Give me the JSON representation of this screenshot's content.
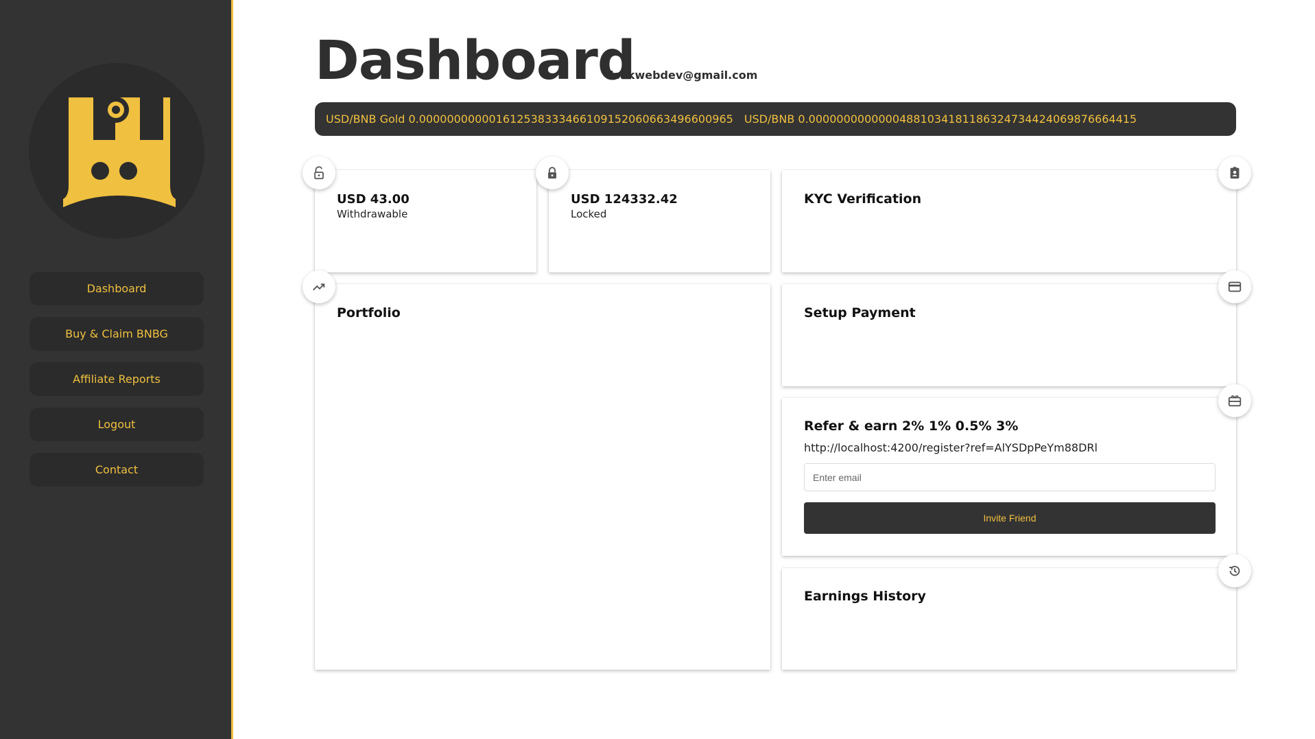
{
  "colors": {
    "sidebar": "#333333",
    "accent": "#f0c040",
    "card": "#ffffff",
    "ticker_bg": "#333333"
  },
  "sidebar": {
    "logo": "crown-logo",
    "items": [
      {
        "label": "Dashboard"
      },
      {
        "label": "Buy & Claim BNBG"
      },
      {
        "label": "Affiliate Reports"
      },
      {
        "label": "Logout"
      },
      {
        "label": "Contact"
      }
    ]
  },
  "header": {
    "title": "Dashboard",
    "email": "isakwebdev@gmail.com"
  },
  "ticker": [
    "USD/BNB Gold 0.0000000000016125383334661091520606634966009​65",
    "USD/BNB 0.000000000000048810341811863247344240698766644​15"
  ],
  "balances": {
    "withdrawable": {
      "amount": "USD 43.00",
      "label": "Withdrawable",
      "icon": "lock-open-icon"
    },
    "locked": {
      "amount": "USD 124332.42",
      "label": "Locked",
      "icon": "lock-icon"
    }
  },
  "kyc": {
    "title": "KYC Verification",
    "icon": "badge-icon"
  },
  "portfolio": {
    "title": "Portfolio",
    "icon": "trending-up-icon"
  },
  "payment": {
    "title": "Setup Payment",
    "icon": "credit-card-icon"
  },
  "refer": {
    "title": "Refer & earn 2% 1% 0.5% 3%",
    "link": "http://localhost:4200/register?ref=AlYSDpPeYm88DRl",
    "email_placeholder": "Enter email",
    "button_label": "Invite Friend",
    "icon": "gift-card-icon"
  },
  "earnings": {
    "title": "Earnings History",
    "icon": "history-icon"
  }
}
